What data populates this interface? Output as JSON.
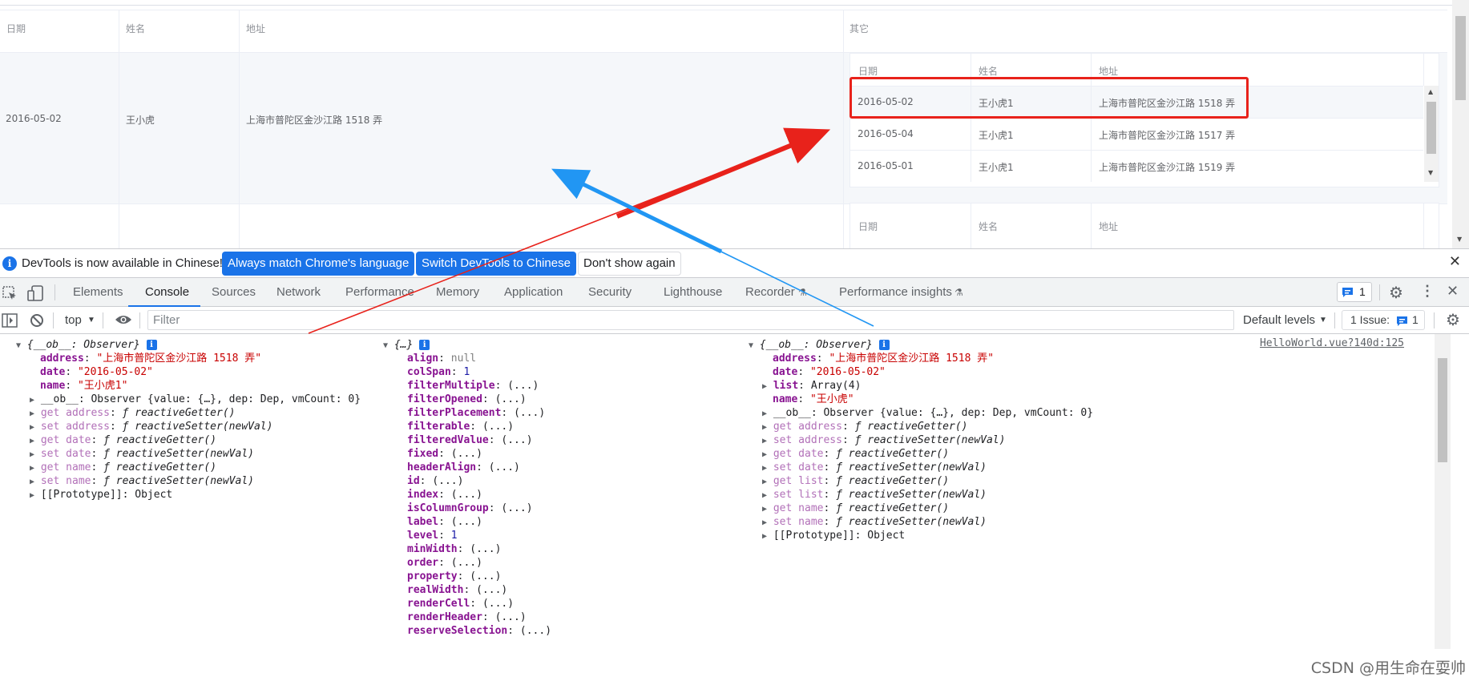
{
  "table": {
    "headers": [
      "日期",
      "姓名",
      "地址",
      "其它"
    ],
    "row1": {
      "date": "2016-05-02",
      "name": "王小虎",
      "address": "上海市普陀区金沙江路 1518 弄"
    },
    "inner_headers": [
      "日期",
      "姓名",
      "地址"
    ],
    "inner_rows": [
      {
        "date": "2016-05-02",
        "name": "王小虎1",
        "address": "上海市普陀区金沙江路 1518 弄"
      },
      {
        "date": "2016-05-04",
        "name": "王小虎1",
        "address": "上海市普陀区金沙江路 1517 弄"
      },
      {
        "date": "2016-05-01",
        "name": "王小虎1",
        "address": "上海市普陀区金沙江路 1519 弄"
      }
    ],
    "inner2_headers": [
      "日期",
      "姓名",
      "地址"
    ]
  },
  "devtools": {
    "infobar": {
      "message": "DevTools is now available in Chinese!",
      "btn_match": "Always match Chrome's language",
      "btn_switch": "Switch DevTools to Chinese",
      "btn_dismiss": "Don't show again"
    },
    "tabs": [
      "Elements",
      "Console",
      "Sources",
      "Network",
      "Performance",
      "Memory",
      "Application",
      "Security",
      "Lighthouse",
      "Recorder",
      "Performance insights"
    ],
    "message_count": "1",
    "filterbar": {
      "context": "top",
      "filter_placeholder": "Filter",
      "levels": "Default levels",
      "issues": "1 Issue:",
      "issues_count": "1"
    },
    "source_link": "HelloWorld.vue?140d:125",
    "col1": {
      "header": "{__ob__: Observer}",
      "address_key": "address",
      "address_val": "\"上海市普陀区金沙江路 1518 弄\"",
      "date_key": "date",
      "date_val": "\"2016-05-02\"",
      "name_key": "name",
      "name_val": "\"王小虎1\"",
      "ob_line": "__ob__: Observer {value: {…}, dep: Dep, vmCount: 0}",
      "accessors": [
        [
          "get address",
          "reactiveGetter()"
        ],
        [
          "set address",
          "reactiveSetter(newVal)"
        ],
        [
          "get date",
          "reactiveGetter()"
        ],
        [
          "set date",
          "reactiveSetter(newVal)"
        ],
        [
          "get name",
          "reactiveGetter()"
        ],
        [
          "set name",
          "reactiveSetter(newVal)"
        ]
      ],
      "proto": "[[Prototype]]: Object"
    },
    "col2": {
      "header": "{…}",
      "props": [
        [
          "align",
          "null"
        ],
        [
          "colSpan",
          "1"
        ],
        [
          "filterMultiple",
          "(...)"
        ],
        [
          "filterOpened",
          "(...)"
        ],
        [
          "filterPlacement",
          "(...)"
        ],
        [
          "filterable",
          "(...)"
        ],
        [
          "filteredValue",
          "(...)"
        ],
        [
          "fixed",
          "(...)"
        ],
        [
          "headerAlign",
          "(...)"
        ],
        [
          "id",
          "(...)"
        ],
        [
          "index",
          "(...)"
        ],
        [
          "isColumnGroup",
          "(...)"
        ],
        [
          "label",
          "(...)"
        ],
        [
          "level",
          "1"
        ],
        [
          "minWidth",
          "(...)"
        ],
        [
          "order",
          "(...)"
        ],
        [
          "property",
          "(...)"
        ],
        [
          "realWidth",
          "(...)"
        ],
        [
          "renderCell",
          "(...)"
        ],
        [
          "renderHeader",
          "(...)"
        ],
        [
          "reserveSelection",
          "(...)"
        ]
      ]
    },
    "col3": {
      "header": "{__ob__: Observer}",
      "address_key": "address",
      "address_val": "\"上海市普陀区金沙江路 1518 弄\"",
      "date_key": "date",
      "date_val": "\"2016-05-02\"",
      "list_key": "list",
      "list_val": "Array(4)",
      "name_key": "name",
      "name_val": "\"王小虎\"",
      "ob_line": "__ob__: Observer {value: {…}, dep: Dep, vmCount: 0}",
      "accessors": [
        [
          "get address",
          "reactiveGetter()"
        ],
        [
          "set address",
          "reactiveSetter(newVal)"
        ],
        [
          "get date",
          "reactiveGetter()"
        ],
        [
          "set date",
          "reactiveSetter(newVal)"
        ],
        [
          "get list",
          "reactiveGetter()"
        ],
        [
          "set list",
          "reactiveSetter(newVal)"
        ],
        [
          "get name",
          "reactiveGetter()"
        ],
        [
          "set name",
          "reactiveSetter(newVal)"
        ]
      ],
      "proto": "[[Prototype]]: Object"
    }
  },
  "watermark": "CSDN @用生命在耍帅",
  "colors": {
    "accent": "#1a73e8",
    "highlight_box": "#e8221b",
    "red_arrow": "#e8221b",
    "blue_arrow": "#2196f3"
  }
}
